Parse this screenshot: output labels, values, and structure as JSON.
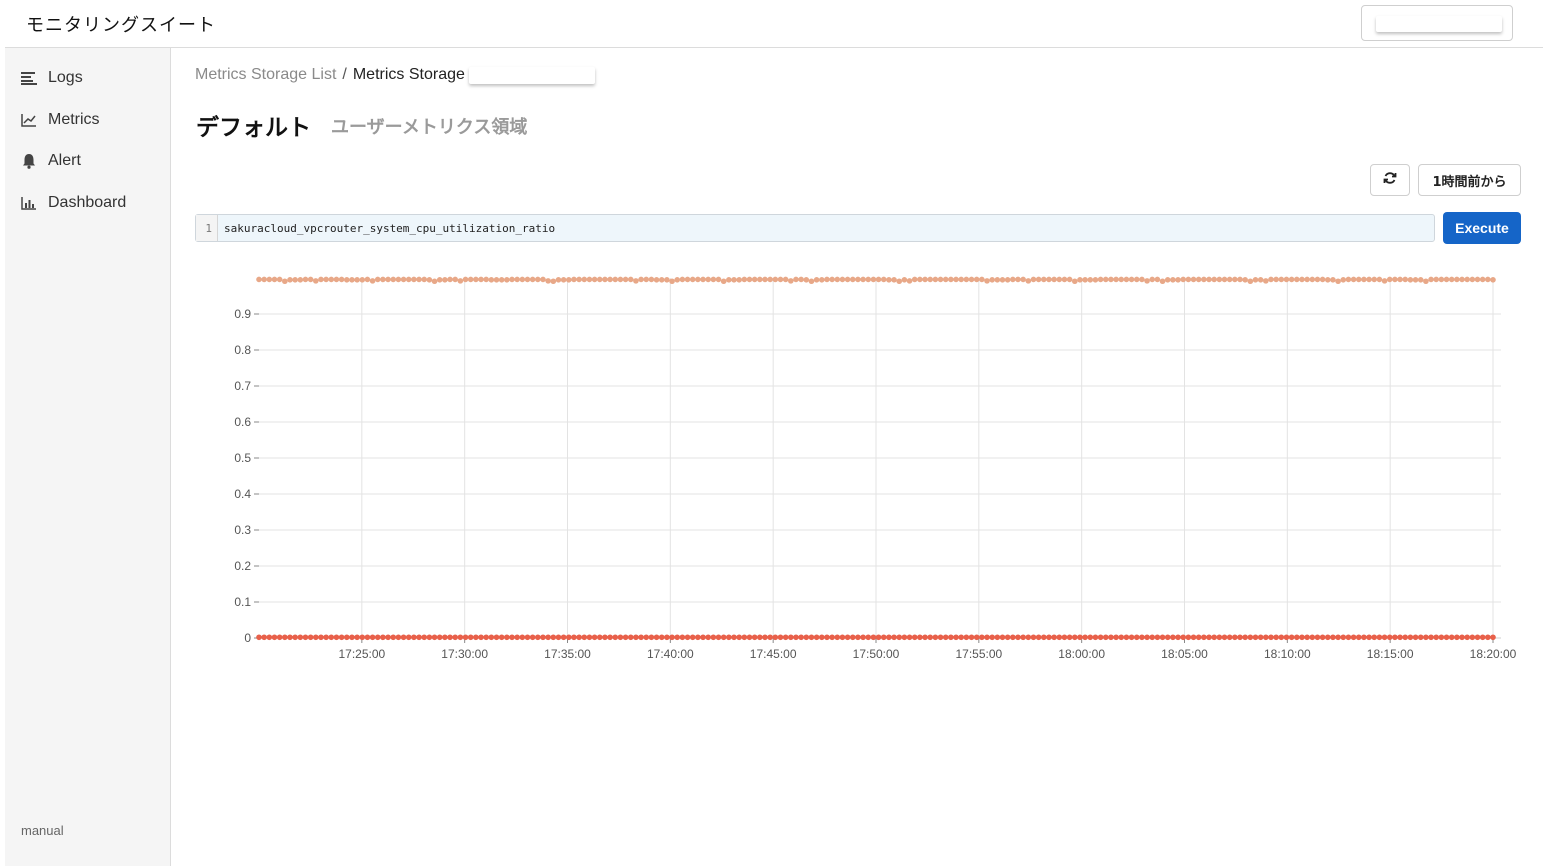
{
  "app": {
    "title": "モニタリングスイート"
  },
  "sidebar": {
    "items": [
      {
        "label": "Logs",
        "icon": "list-icon"
      },
      {
        "label": "Metrics",
        "icon": "line-chart-icon"
      },
      {
        "label": "Alert",
        "icon": "bell-icon"
      },
      {
        "label": "Dashboard",
        "icon": "bar-chart-icon"
      }
    ],
    "footer": "manual"
  },
  "breadcrumb": {
    "parent": "Metrics Storage List",
    "separator": "/",
    "current": "Metrics Storage"
  },
  "page": {
    "title": "デフォルト",
    "subtitle": "ユーザーメトリクス領域"
  },
  "toolbar": {
    "refresh_icon": "refresh-icon",
    "range_label": "1時間前から",
    "execute_label": "Execute"
  },
  "query": {
    "line_number": "1",
    "text": "sakuracloud_vpcrouter_system_cpu_utilization_ratio"
  },
  "colors": {
    "accent": "#1565c8",
    "series_high": "#e8a888",
    "series_low": "#e8604a",
    "series_low_alt": "#7fb09a"
  },
  "chart_data": {
    "type": "scatter",
    "x_tick_labels": [
      "17:25:00",
      "17:30:00",
      "17:35:00",
      "17:40:00",
      "17:45:00",
      "17:50:00",
      "17:55:00",
      "18:00:00",
      "18:05:00",
      "18:10:00",
      "18:15:00",
      "18:20:00"
    ],
    "x_range": [
      "17:20:00",
      "18:20:00"
    ],
    "y_tick_labels": [
      "0",
      "0.1",
      "0.2",
      "0.3",
      "0.4",
      "0.5",
      "0.6",
      "0.7",
      "0.8",
      "0.9"
    ],
    "ylim": [
      0,
      1.0
    ],
    "grid": true,
    "series": [
      {
        "color": "#e8a888",
        "values": [
          0.996,
          0.995,
          0.996,
          0.996,
          0.995,
          0.996,
          0.996,
          0.996,
          0.995,
          0.996,
          0.996,
          0.995,
          0.996,
          0.996,
          0.995,
          0.996,
          0.996,
          0.996,
          0.996,
          0.995,
          0.996,
          0.996,
          0.995,
          0.996,
          0.996,
          0.996,
          0.995,
          0.996,
          0.996,
          0.996,
          0.995,
          0.996,
          0.996,
          0.996,
          0.996,
          0.995,
          0.996,
          0.996,
          0.996,
          0.995,
          0.996,
          0.996,
          0.996,
          0.995,
          0.996,
          0.996,
          0.996,
          0.995,
          0.996,
          0.996,
          0.996,
          0.995,
          0.996,
          0.996,
          0.996,
          0.995,
          0.996,
          0.996,
          0.996,
          0.995
        ]
      },
      {
        "color": "#e8604a",
        "values": [
          0.002,
          0.002,
          0.002,
          0.002,
          0.002,
          0.002,
          0.002,
          0.002,
          0.002,
          0.002,
          0.002,
          0.002,
          0.002,
          0.002,
          0.002,
          0.002,
          0.002,
          0.002,
          0.002,
          0.002,
          0.002,
          0.002,
          0.002,
          0.002,
          0.002,
          0.002,
          0.002,
          0.002,
          0.002,
          0.002,
          0.002,
          0.002,
          0.002,
          0.002,
          0.002,
          0.002,
          0.002,
          0.002,
          0.002,
          0.002,
          0.002,
          0.002,
          0.002,
          0.002,
          0.002,
          0.002,
          0.002,
          0.002,
          0.002,
          0.002,
          0.002,
          0.002,
          0.002,
          0.002,
          0.002,
          0.002,
          0.002,
          0.002,
          0.002,
          0.002
        ]
      }
    ]
  }
}
